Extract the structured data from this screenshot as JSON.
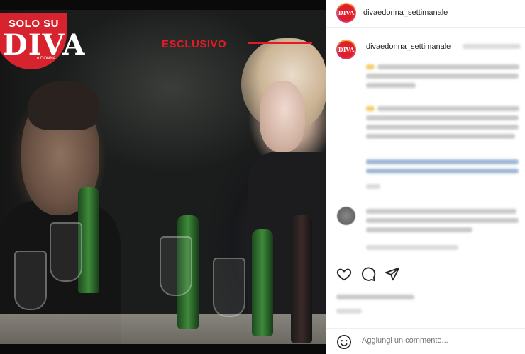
{
  "photo": {
    "logo_top": "SOLO SU",
    "logo_main": "DIVA",
    "logo_sub": "e DONNA",
    "badge": "ESCLUSIVO"
  },
  "post": {
    "account": "divaedonna_settimanale",
    "avatar_text": "DIVA"
  },
  "comment_box": {
    "placeholder": "Aggiungi un commento..."
  },
  "icons": [
    "heart-icon",
    "comment-icon",
    "share-icon",
    "emoji-icon"
  ],
  "colors": {
    "brand_red": "#e21b25",
    "publish_blue": "#b2dffc"
  }
}
